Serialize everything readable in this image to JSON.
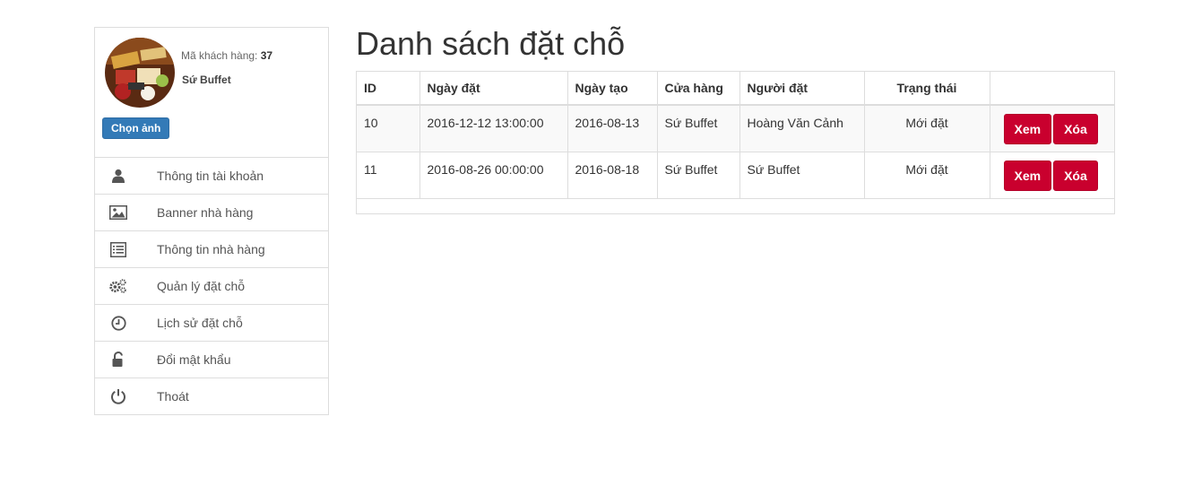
{
  "profile": {
    "customer_id_label": "Mã khách hàng:",
    "customer_id": "37",
    "customer_name": "Sứ Buffet",
    "choose_image_label": "Chọn ảnh"
  },
  "sidebar": {
    "items": [
      {
        "label": "Thông tin tài khoản",
        "icon": "user-icon"
      },
      {
        "label": "Banner nhà hàng",
        "icon": "picture-icon"
      },
      {
        "label": "Thông tin nhà hàng",
        "icon": "list-alt-icon"
      },
      {
        "label": "Quản lý đặt chỗ",
        "icon": "cogs-icon"
      },
      {
        "label": "Lịch sử đặt chỗ",
        "icon": "clock-icon"
      },
      {
        "label": "Đổi mật khẩu",
        "icon": "unlock-icon"
      },
      {
        "label": "Thoát",
        "icon": "power-icon"
      }
    ]
  },
  "main": {
    "title": "Danh sách đặt chỗ",
    "table": {
      "headers": [
        "ID",
        "Ngày đặt",
        "Ngày tạo",
        "Cửa hàng",
        "Người đặt",
        "Trạng thái",
        ""
      ],
      "rows": [
        {
          "id": "10",
          "booking_date": "2016-12-12 13:00:00",
          "created_date": "2016-08-13",
          "store": "Sứ Buffet",
          "booker": "Hoàng Văn Cảnh",
          "status": "Mới đặt",
          "view_label": "Xem",
          "delete_label": "Xóa"
        },
        {
          "id": "11",
          "booking_date": "2016-08-26 00:00:00",
          "created_date": "2016-08-18",
          "store": "Sứ Buffet",
          "booker": "Sứ Buffet",
          "status": "Mới đặt",
          "view_label": "Xem",
          "delete_label": "Xóa"
        }
      ]
    }
  },
  "colors": {
    "primary_button": "#337ab7",
    "danger_button": "#c9002e",
    "border": "#dddddd"
  }
}
